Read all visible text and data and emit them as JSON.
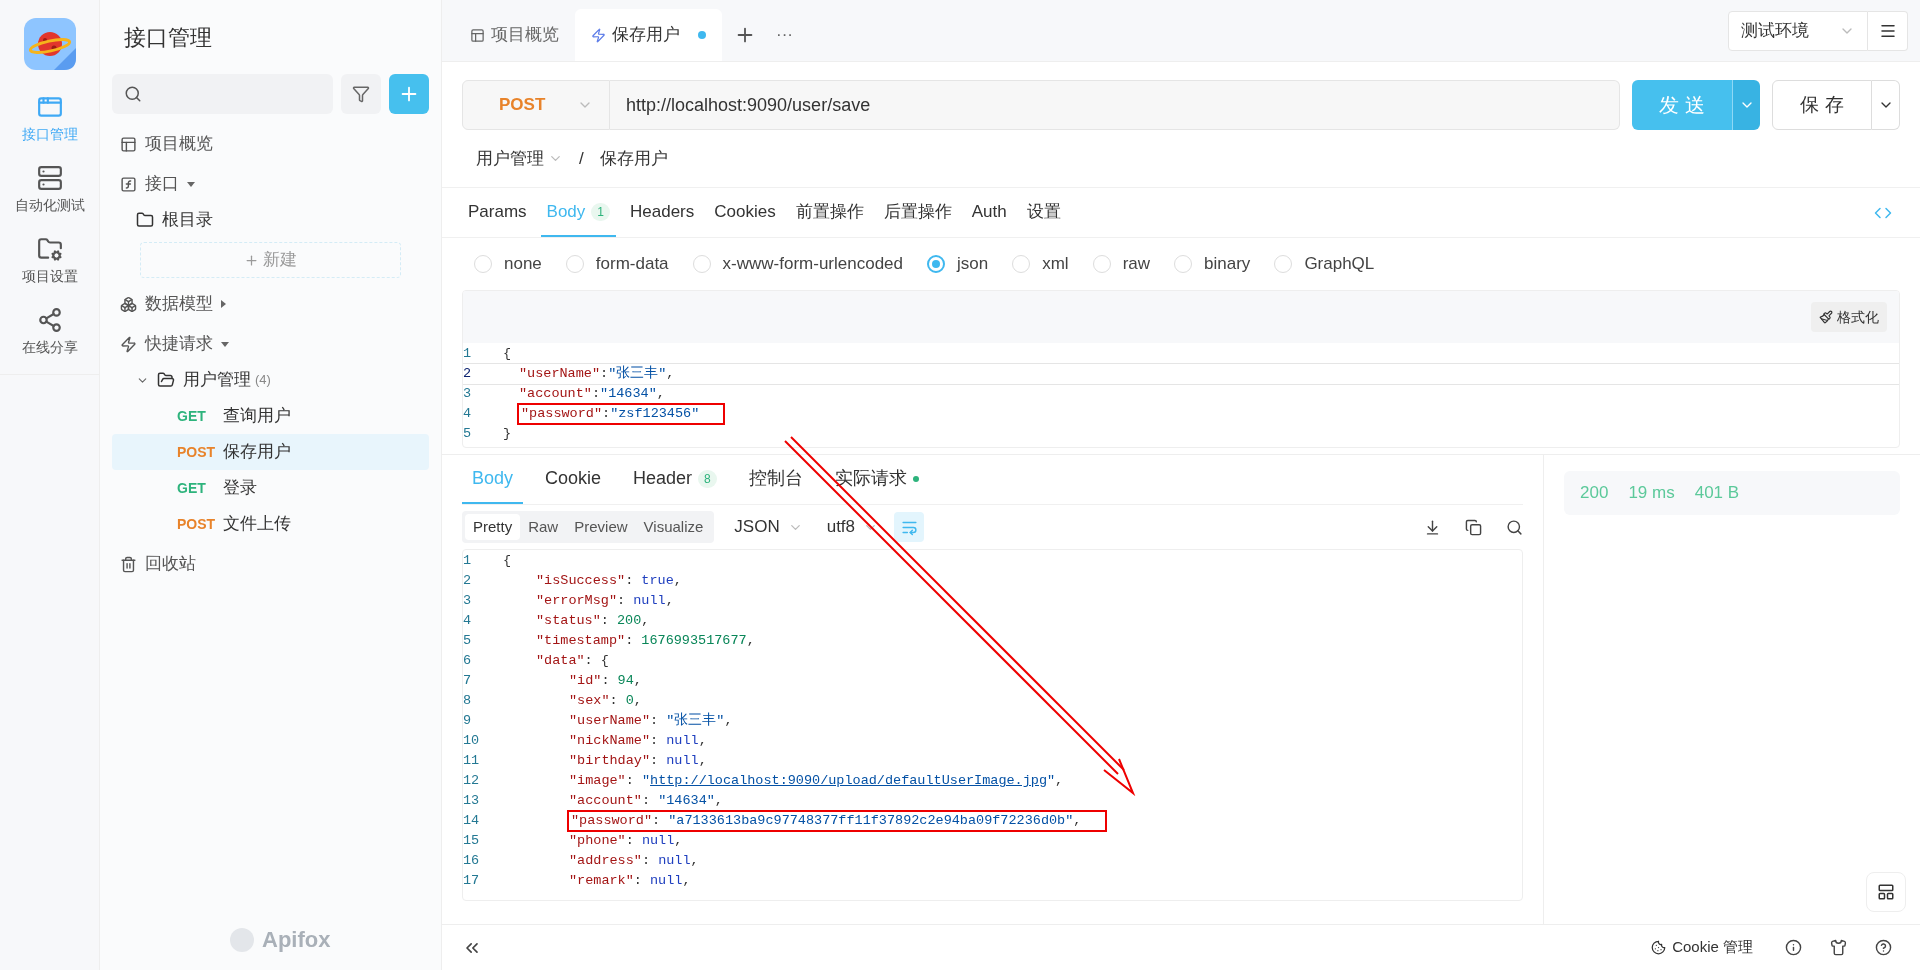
{
  "rail": {
    "items": [
      {
        "label": "接口管理",
        "selected": true
      },
      {
        "label": "自动化测试",
        "selected": false
      },
      {
        "label": "项目设置",
        "selected": false
      },
      {
        "label": "在线分享",
        "selected": false
      }
    ]
  },
  "sidebar": {
    "title": "接口管理",
    "brand": "Apifox",
    "tree": [
      {
        "kind": "page",
        "label": "项目概览"
      },
      {
        "kind": "group",
        "label": "接口",
        "expanded": true,
        "children": [
          {
            "kind": "folder",
            "label": "根目录",
            "expanded": false
          }
        ],
        "new_button": "新建"
      },
      {
        "kind": "group",
        "label": "数据模型",
        "expanded": false
      },
      {
        "kind": "group",
        "label": "快捷请求",
        "expanded": true,
        "children": [
          {
            "kind": "folder",
            "label": "用户管理",
            "count": "(4)",
            "expanded": true,
            "children": [
              {
                "kind": "request",
                "method": "GET",
                "color": "#2db37c",
                "label": "查询用户",
                "selected": false
              },
              {
                "kind": "request",
                "method": "POST",
                "color": "#e8832a",
                "label": "保存用户",
                "selected": true
              },
              {
                "kind": "request",
                "method": "GET",
                "color": "#2db37c",
                "label": "登录",
                "selected": false
              },
              {
                "kind": "request",
                "method": "POST",
                "color": "#e8832a",
                "label": "文件上传",
                "selected": false
              }
            ]
          }
        ]
      },
      {
        "kind": "trash",
        "label": "回收站"
      }
    ]
  },
  "tabs": [
    {
      "label": "项目概览",
      "kind": "overview",
      "selected": false,
      "unsaved": false
    },
    {
      "label": "保存用户",
      "kind": "request",
      "selected": true,
      "unsaved": true
    }
  ],
  "tab_more": "···",
  "environment": "测试环境",
  "request": {
    "method": "POST",
    "url": "http://localhost:9090/user/save",
    "send": "发 送",
    "save": "保 存",
    "breadcrumb": [
      "用户管理",
      "/",
      "保存用户"
    ],
    "tabs": [
      {
        "label": "Params",
        "selected": false
      },
      {
        "label": "Body",
        "badge": "1",
        "selected": true
      },
      {
        "label": "Headers",
        "selected": false
      },
      {
        "label": "Cookies",
        "selected": false
      },
      {
        "label": "前置操作",
        "selected": false
      },
      {
        "label": "后置操作",
        "selected": false
      },
      {
        "label": "Auth",
        "selected": false
      },
      {
        "label": "设置",
        "selected": false
      }
    ],
    "body_types": [
      {
        "label": "none",
        "selected": false
      },
      {
        "label": "form-data",
        "selected": false
      },
      {
        "label": "x-www-form-urlencoded",
        "selected": false
      },
      {
        "label": "json",
        "selected": true
      },
      {
        "label": "xml",
        "selected": false
      },
      {
        "label": "raw",
        "selected": false
      },
      {
        "label": "binary",
        "selected": false
      },
      {
        "label": "GraphQL",
        "selected": false
      }
    ],
    "format_button": "格式化",
    "code": [
      {
        "n": "1",
        "active": false,
        "highlighted": false,
        "parts": [
          {
            "kind": "p",
            "text": "{"
          }
        ],
        "children": [
          {
            "n": "2",
            "active": true,
            "highlighted": false,
            "parts": [
              {
                "kind": "key",
                "text": "\"userName\""
              },
              {
                "kind": "p",
                "text": ":"
              },
              {
                "kind": "str",
                "text": "\"张三丰\""
              },
              {
                "kind": "p",
                "text": ","
              }
            ]
          },
          {
            "n": "3",
            "active": false,
            "highlighted": false,
            "parts": [
              {
                "kind": "key",
                "text": "\"account\""
              },
              {
                "kind": "p",
                "text": ":"
              },
              {
                "kind": "str",
                "text": "\"14634\""
              },
              {
                "kind": "p",
                "text": ","
              }
            ]
          },
          {
            "n": "4",
            "active": false,
            "highlighted": true,
            "parts": [
              {
                "kind": "key",
                "text": "\"password\""
              },
              {
                "kind": "p",
                "text": ":"
              },
              {
                "kind": "str",
                "text": "\"zsf123456\""
              }
            ]
          }
        ]
      },
      {
        "n": "5",
        "active": false,
        "highlighted": false,
        "parts": [
          {
            "kind": "p",
            "text": "}"
          }
        ]
      }
    ]
  },
  "response": {
    "tabs": [
      {
        "label": "Body",
        "selected": true
      },
      {
        "label": "Cookie",
        "selected": false
      },
      {
        "label": "Header",
        "badge": "8",
        "selected": false
      },
      {
        "label": "控制台",
        "selected": false
      },
      {
        "label": "实际请求",
        "dot": true,
        "selected": false
      }
    ],
    "views": [
      {
        "label": "Pretty",
        "selected": true
      },
      {
        "label": "Raw",
        "selected": false
      },
      {
        "label": "Preview",
        "selected": false
      },
      {
        "label": "Visualize",
        "selected": false
      }
    ],
    "format": "JSON",
    "encoding": "utf8",
    "wrap_on": true,
    "code": [
      {
        "n": "1",
        "highlighted": false,
        "parts": [
          {
            "kind": "p",
            "text": "{"
          }
        ],
        "children": [
          {
            "n": "2",
            "highlighted": false,
            "parts": [
              {
                "kind": "key",
                "text": "\"isSuccess\""
              },
              {
                "kind": "p",
                "text": ": "
              },
              {
                "kind": "kw",
                "text": "true"
              },
              {
                "kind": "p",
                "text": ","
              }
            ]
          },
          {
            "n": "3",
            "highlighted": false,
            "parts": [
              {
                "kind": "key",
                "text": "\"errorMsg\""
              },
              {
                "kind": "p",
                "text": ": "
              },
              {
                "kind": "kw",
                "text": "null"
              },
              {
                "kind": "p",
                "text": ","
              }
            ]
          },
          {
            "n": "4",
            "highlighted": false,
            "parts": [
              {
                "kind": "key",
                "text": "\"status\""
              },
              {
                "kind": "p",
                "text": ": "
              },
              {
                "kind": "num",
                "text": "200"
              },
              {
                "kind": "p",
                "text": ","
              }
            ]
          },
          {
            "n": "5",
            "highlighted": false,
            "parts": [
              {
                "kind": "key",
                "text": "\"timestamp\""
              },
              {
                "kind": "p",
                "text": ": "
              },
              {
                "kind": "num",
                "text": "1676993517677"
              },
              {
                "kind": "p",
                "text": ","
              }
            ]
          },
          {
            "n": "6",
            "highlighted": false,
            "parts": [
              {
                "kind": "key",
                "text": "\"data\""
              },
              {
                "kind": "p",
                "text": ": {"
              }
            ],
            "children": [
              {
                "n": "7",
                "highlighted": false,
                "parts": [
                  {
                    "kind": "key",
                    "text": "\"id\""
                  },
                  {
                    "kind": "p",
                    "text": ": "
                  },
                  {
                    "kind": "num",
                    "text": "94"
                  },
                  {
                    "kind": "p",
                    "text": ","
                  }
                ]
              },
              {
                "n": "8",
                "highlighted": false,
                "parts": [
                  {
                    "kind": "key",
                    "text": "\"sex\""
                  },
                  {
                    "kind": "p",
                    "text": ": "
                  },
                  {
                    "kind": "num",
                    "text": "0"
                  },
                  {
                    "kind": "p",
                    "text": ","
                  }
                ]
              },
              {
                "n": "9",
                "highlighted": false,
                "parts": [
                  {
                    "kind": "key",
                    "text": "\"userName\""
                  },
                  {
                    "kind": "p",
                    "text": ": "
                  },
                  {
                    "kind": "str",
                    "text": "\"张三丰\""
                  },
                  {
                    "kind": "p",
                    "text": ","
                  }
                ]
              },
              {
                "n": "10",
                "highlighted": false,
                "parts": [
                  {
                    "kind": "key",
                    "text": "\"nickName\""
                  },
                  {
                    "kind": "p",
                    "text": ": "
                  },
                  {
                    "kind": "kw",
                    "text": "null"
                  },
                  {
                    "kind": "p",
                    "text": ","
                  }
                ]
              },
              {
                "n": "11",
                "highlighted": false,
                "parts": [
                  {
                    "kind": "key",
                    "text": "\"birthday\""
                  },
                  {
                    "kind": "p",
                    "text": ": "
                  },
                  {
                    "kind": "kw",
                    "text": "null"
                  },
                  {
                    "kind": "p",
                    "text": ","
                  }
                ]
              },
              {
                "n": "12",
                "highlighted": false,
                "parts": [
                  {
                    "kind": "key",
                    "text": "\"image\""
                  },
                  {
                    "kind": "p",
                    "text": ": "
                  },
                  {
                    "kind": "str",
                    "text": "\""
                  },
                  {
                    "kind": "link",
                    "text": "http://localhost:9090/upload/defaultUserImage.jpg"
                  },
                  {
                    "kind": "str",
                    "text": "\""
                  },
                  {
                    "kind": "p",
                    "text": ","
                  }
                ]
              },
              {
                "n": "13",
                "highlighted": false,
                "parts": [
                  {
                    "kind": "key",
                    "text": "\"account\""
                  },
                  {
                    "kind": "p",
                    "text": ": "
                  },
                  {
                    "kind": "str",
                    "text": "\"14634\""
                  },
                  {
                    "kind": "p",
                    "text": ","
                  }
                ]
              },
              {
                "n": "14",
                "highlighted": true,
                "parts": [
                  {
                    "kind": "key",
                    "text": "\"password\""
                  },
                  {
                    "kind": "p",
                    "text": ": "
                  },
                  {
                    "kind": "str",
                    "text": "\"a7133613ba9c97748377ff11f37892c2e94ba09f72236d0b\""
                  },
                  {
                    "kind": "p",
                    "text": ","
                  }
                ]
              },
              {
                "n": "15",
                "highlighted": false,
                "parts": [
                  {
                    "kind": "key",
                    "text": "\"phone\""
                  },
                  {
                    "kind": "p",
                    "text": ": "
                  },
                  {
                    "kind": "kw",
                    "text": "null"
                  },
                  {
                    "kind": "p",
                    "text": ","
                  }
                ]
              },
              {
                "n": "16",
                "highlighted": false,
                "parts": [
                  {
                    "kind": "key",
                    "text": "\"address\""
                  },
                  {
                    "kind": "p",
                    "text": ": "
                  },
                  {
                    "kind": "kw",
                    "text": "null"
                  },
                  {
                    "kind": "p",
                    "text": ","
                  }
                ]
              },
              {
                "n": "17",
                "highlighted": false,
                "parts": [
                  {
                    "kind": "key",
                    "text": "\"remark\""
                  },
                  {
                    "kind": "p",
                    "text": ": "
                  },
                  {
                    "kind": "kw",
                    "text": "null"
                  },
                  {
                    "kind": "p",
                    "text": ","
                  }
                ]
              }
            ]
          }
        ]
      }
    ],
    "status": [
      "200",
      "19 ms",
      "401 B"
    ]
  },
  "annotation": {
    "arrow": true
  },
  "status_bar": {
    "cookie_manager": "Cookie 管理"
  }
}
